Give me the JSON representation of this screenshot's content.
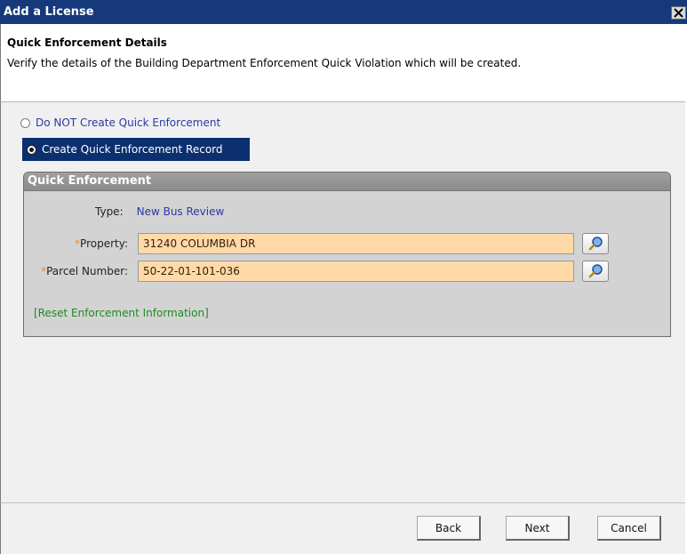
{
  "window": {
    "title": "Add a License"
  },
  "header": {
    "title": "Quick Enforcement Details",
    "description": "Verify the details of the Building Department Enforcement Quick Violation which will be created."
  },
  "options": [
    {
      "label": "Do NOT Create Quick Enforcement",
      "selected": false
    },
    {
      "label": "Create Quick Enforcement Record",
      "selected": true
    }
  ],
  "panel": {
    "title": "Quick Enforcement",
    "type_label": "Type:",
    "type_value": "New Bus Review",
    "property_label": "Property:",
    "property_value": "31240 COLUMBIA DR",
    "parcel_label": "Parcel Number:",
    "parcel_value": "50-22-01-101-036",
    "required_marker": "*",
    "reset_link": "[Reset Enforcement Information]"
  },
  "footer": {
    "back": "Back",
    "next": "Next",
    "cancel": "Cancel"
  },
  "colors": {
    "titlebar": "#15397a",
    "selected_option": "#0b2f6f",
    "field_bg": "#ffd9a8",
    "link": "#2a3aa5",
    "reset_link": "#1f8a1f"
  },
  "icons": {
    "close": "close-icon",
    "lookup": "magnifier-icon"
  }
}
